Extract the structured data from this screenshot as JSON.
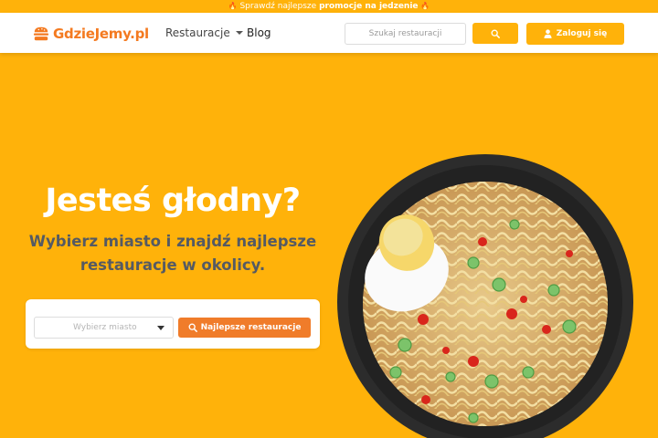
{
  "promo": {
    "prefix": "Sprawdź najlepsze ",
    "bold": "promocje na jedzenie"
  },
  "nav": {
    "logo_text": "GdzieJemy.pl",
    "restaurants_label": "Restauracje",
    "blog_label": "Blog",
    "search_placeholder": "Szukaj restauracji",
    "login_label": "Zaloguj się"
  },
  "hero": {
    "title": "Jesteś głodny?",
    "subtitle_line1": "Wybierz miasto i znajdź najlepsze",
    "subtitle_line2": "restauracje w okolicy."
  },
  "search_card": {
    "city_placeholder": "Wybierz miasto",
    "button_label": "Najlepsze restauracje"
  },
  "colors": {
    "brand_yellow": "#ffb20a",
    "brand_orange": "#f07c2a",
    "logo_orange": "#f47a20"
  },
  "icons": {
    "promo": "flame-icon",
    "logo": "burger-icon",
    "search": "search-icon",
    "login": "user-icon",
    "dropdown": "caret-down-icon"
  }
}
